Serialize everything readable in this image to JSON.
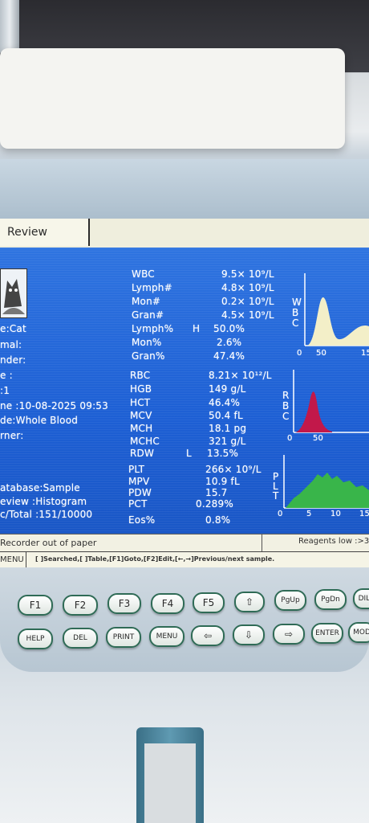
{
  "window": {
    "title": "Review"
  },
  "patient": {
    "species": "e:Cat",
    "name_label": "mal:",
    "gender_label": "nder:",
    "age_label": "e :",
    "sample_no": ":1",
    "datetime": "ne :10-08-2025 09:53",
    "mode": "de:Whole Blood",
    "owner_label": "rner:"
  },
  "results": {
    "wbc_group": [
      {
        "name": "WBC",
        "flag": "",
        "value": "9.5× 10⁹/L"
      },
      {
        "name": "Lymph#",
        "flag": "",
        "value": "4.8× 10⁹/L"
      },
      {
        "name": "Mon#",
        "flag": "",
        "value": "0.2× 10⁹/L"
      },
      {
        "name": "Gran#",
        "flag": "",
        "value": "4.5× 10⁹/L"
      },
      {
        "name": "Lymph%",
        "flag": "H",
        "value": "50.0%"
      },
      {
        "name": "Mon%",
        "flag": "",
        "value": "2.6%"
      },
      {
        "name": "Gran%",
        "flag": "",
        "value": "47.4%"
      }
    ],
    "rbc_group": [
      {
        "name": "RBC",
        "flag": "",
        "value": "8.21× 10¹²/L"
      },
      {
        "name": "HGB",
        "flag": "",
        "value": "149 g/L"
      },
      {
        "name": "HCT",
        "flag": "",
        "value": "46.4%"
      },
      {
        "name": "MCV",
        "flag": "",
        "value": "50.4 fL"
      },
      {
        "name": "MCH",
        "flag": "",
        "value": "18.1 pg"
      },
      {
        "name": "MCHC",
        "flag": "",
        "value": "321 g/L"
      },
      {
        "name": "RDW",
        "flag": "L",
        "value": "13.5%"
      }
    ],
    "plt_group": [
      {
        "name": "PLT",
        "flag": "",
        "value": "266× 10⁹/L"
      },
      {
        "name": "MPV",
        "flag": "",
        "value": "10.9 fL"
      },
      {
        "name": "PDW",
        "flag": "",
        "value": "15.7"
      },
      {
        "name": "PCT",
        "flag": "",
        "value": "0.289%"
      }
    ],
    "eos": {
      "name": "Eos%",
      "value": "0.8%"
    }
  },
  "histograms": {
    "wbc": {
      "label_chars": [
        "W",
        "B",
        "C"
      ],
      "ticks": [
        "0",
        "50",
        "15"
      ],
      "fill": "#f3efc8"
    },
    "rbc": {
      "label_chars": [
        "R",
        "B",
        "C"
      ],
      "ticks": [
        "0",
        "50"
      ],
      "fill": "#c2184a"
    },
    "plt": {
      "label_chars": [
        "P",
        "L",
        "T"
      ],
      "ticks": [
        "0",
        "5",
        "10",
        "15"
      ],
      "fill": "#39b54a"
    }
  },
  "info": {
    "database": "atabase:Sample",
    "review": "eview   :Histogram",
    "total": "c/Total :151/10000"
  },
  "status": {
    "message": "Recorder out of paper",
    "reagents": "Reagents low :>3"
  },
  "menu_bar": {
    "label": "MENU",
    "hint": "[ ]Searched,[ ]Table,[F1]Goto,[F2]Edit,[←,→]Previous/next sample."
  },
  "keys": {
    "row1": [
      "F1",
      "F2",
      "F3",
      "F4",
      "F5",
      "⇧",
      "PgUp",
      "PgDn",
      "DILU"
    ],
    "row2": [
      "HELP",
      "DEL",
      "PRINT",
      "MENU",
      "⇦",
      "⇩",
      "⇨",
      "ENTER",
      "MOD"
    ]
  }
}
